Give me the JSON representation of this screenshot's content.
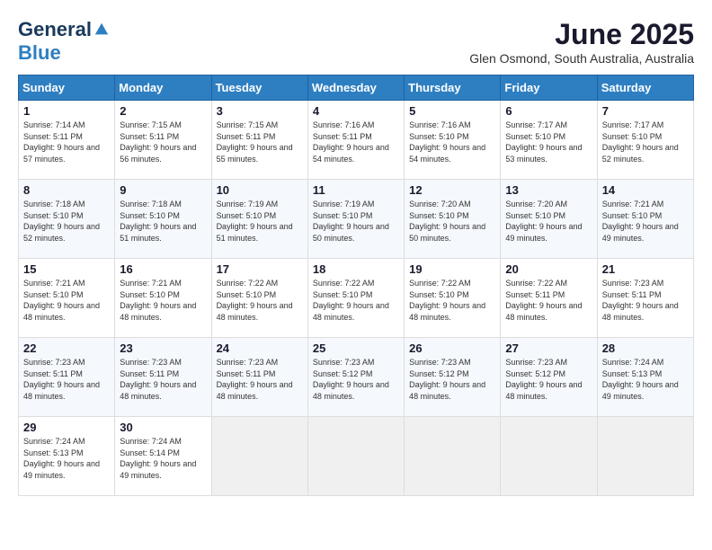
{
  "header": {
    "logo_general": "General",
    "logo_blue": "Blue",
    "month_year": "June 2025",
    "location": "Glen Osmond, South Australia, Australia"
  },
  "weekdays": [
    "Sunday",
    "Monday",
    "Tuesday",
    "Wednesday",
    "Thursday",
    "Friday",
    "Saturday"
  ],
  "weeks": [
    [
      {
        "day": "1",
        "sunrise": "Sunrise: 7:14 AM",
        "sunset": "Sunset: 5:11 PM",
        "daylight": "Daylight: 9 hours and 57 minutes."
      },
      {
        "day": "2",
        "sunrise": "Sunrise: 7:15 AM",
        "sunset": "Sunset: 5:11 PM",
        "daylight": "Daylight: 9 hours and 56 minutes."
      },
      {
        "day": "3",
        "sunrise": "Sunrise: 7:15 AM",
        "sunset": "Sunset: 5:11 PM",
        "daylight": "Daylight: 9 hours and 55 minutes."
      },
      {
        "day": "4",
        "sunrise": "Sunrise: 7:16 AM",
        "sunset": "Sunset: 5:11 PM",
        "daylight": "Daylight: 9 hours and 54 minutes."
      },
      {
        "day": "5",
        "sunrise": "Sunrise: 7:16 AM",
        "sunset": "Sunset: 5:10 PM",
        "daylight": "Daylight: 9 hours and 54 minutes."
      },
      {
        "day": "6",
        "sunrise": "Sunrise: 7:17 AM",
        "sunset": "Sunset: 5:10 PM",
        "daylight": "Daylight: 9 hours and 53 minutes."
      },
      {
        "day": "7",
        "sunrise": "Sunrise: 7:17 AM",
        "sunset": "Sunset: 5:10 PM",
        "daylight": "Daylight: 9 hours and 52 minutes."
      }
    ],
    [
      {
        "day": "8",
        "sunrise": "Sunrise: 7:18 AM",
        "sunset": "Sunset: 5:10 PM",
        "daylight": "Daylight: 9 hours and 52 minutes."
      },
      {
        "day": "9",
        "sunrise": "Sunrise: 7:18 AM",
        "sunset": "Sunset: 5:10 PM",
        "daylight": "Daylight: 9 hours and 51 minutes."
      },
      {
        "day": "10",
        "sunrise": "Sunrise: 7:19 AM",
        "sunset": "Sunset: 5:10 PM",
        "daylight": "Daylight: 9 hours and 51 minutes."
      },
      {
        "day": "11",
        "sunrise": "Sunrise: 7:19 AM",
        "sunset": "Sunset: 5:10 PM",
        "daylight": "Daylight: 9 hours and 50 minutes."
      },
      {
        "day": "12",
        "sunrise": "Sunrise: 7:20 AM",
        "sunset": "Sunset: 5:10 PM",
        "daylight": "Daylight: 9 hours and 50 minutes."
      },
      {
        "day": "13",
        "sunrise": "Sunrise: 7:20 AM",
        "sunset": "Sunset: 5:10 PM",
        "daylight": "Daylight: 9 hours and 49 minutes."
      },
      {
        "day": "14",
        "sunrise": "Sunrise: 7:21 AM",
        "sunset": "Sunset: 5:10 PM",
        "daylight": "Daylight: 9 hours and 49 minutes."
      }
    ],
    [
      {
        "day": "15",
        "sunrise": "Sunrise: 7:21 AM",
        "sunset": "Sunset: 5:10 PM",
        "daylight": "Daylight: 9 hours and 48 minutes."
      },
      {
        "day": "16",
        "sunrise": "Sunrise: 7:21 AM",
        "sunset": "Sunset: 5:10 PM",
        "daylight": "Daylight: 9 hours and 48 minutes."
      },
      {
        "day": "17",
        "sunrise": "Sunrise: 7:22 AM",
        "sunset": "Sunset: 5:10 PM",
        "daylight": "Daylight: 9 hours and 48 minutes."
      },
      {
        "day": "18",
        "sunrise": "Sunrise: 7:22 AM",
        "sunset": "Sunset: 5:10 PM",
        "daylight": "Daylight: 9 hours and 48 minutes."
      },
      {
        "day": "19",
        "sunrise": "Sunrise: 7:22 AM",
        "sunset": "Sunset: 5:10 PM",
        "daylight": "Daylight: 9 hours and 48 minutes."
      },
      {
        "day": "20",
        "sunrise": "Sunrise: 7:22 AM",
        "sunset": "Sunset: 5:11 PM",
        "daylight": "Daylight: 9 hours and 48 minutes."
      },
      {
        "day": "21",
        "sunrise": "Sunrise: 7:23 AM",
        "sunset": "Sunset: 5:11 PM",
        "daylight": "Daylight: 9 hours and 48 minutes."
      }
    ],
    [
      {
        "day": "22",
        "sunrise": "Sunrise: 7:23 AM",
        "sunset": "Sunset: 5:11 PM",
        "daylight": "Daylight: 9 hours and 48 minutes."
      },
      {
        "day": "23",
        "sunrise": "Sunrise: 7:23 AM",
        "sunset": "Sunset: 5:11 PM",
        "daylight": "Daylight: 9 hours and 48 minutes."
      },
      {
        "day": "24",
        "sunrise": "Sunrise: 7:23 AM",
        "sunset": "Sunset: 5:11 PM",
        "daylight": "Daylight: 9 hours and 48 minutes."
      },
      {
        "day": "25",
        "sunrise": "Sunrise: 7:23 AM",
        "sunset": "Sunset: 5:12 PM",
        "daylight": "Daylight: 9 hours and 48 minutes."
      },
      {
        "day": "26",
        "sunrise": "Sunrise: 7:23 AM",
        "sunset": "Sunset: 5:12 PM",
        "daylight": "Daylight: 9 hours and 48 minutes."
      },
      {
        "day": "27",
        "sunrise": "Sunrise: 7:23 AM",
        "sunset": "Sunset: 5:12 PM",
        "daylight": "Daylight: 9 hours and 48 minutes."
      },
      {
        "day": "28",
        "sunrise": "Sunrise: 7:24 AM",
        "sunset": "Sunset: 5:13 PM",
        "daylight": "Daylight: 9 hours and 49 minutes."
      }
    ],
    [
      {
        "day": "29",
        "sunrise": "Sunrise: 7:24 AM",
        "sunset": "Sunset: 5:13 PM",
        "daylight": "Daylight: 9 hours and 49 minutes."
      },
      {
        "day": "30",
        "sunrise": "Sunrise: 7:24 AM",
        "sunset": "Sunset: 5:14 PM",
        "daylight": "Daylight: 9 hours and 49 minutes."
      },
      {
        "day": "",
        "sunrise": "",
        "sunset": "",
        "daylight": ""
      },
      {
        "day": "",
        "sunrise": "",
        "sunset": "",
        "daylight": ""
      },
      {
        "day": "",
        "sunrise": "",
        "sunset": "",
        "daylight": ""
      },
      {
        "day": "",
        "sunrise": "",
        "sunset": "",
        "daylight": ""
      },
      {
        "day": "",
        "sunrise": "",
        "sunset": "",
        "daylight": ""
      }
    ]
  ]
}
